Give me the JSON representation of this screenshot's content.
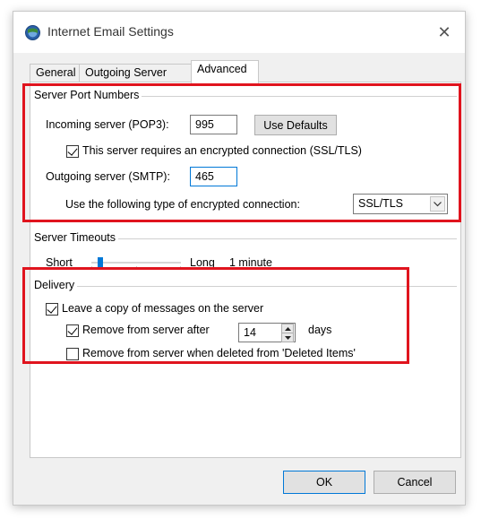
{
  "window": {
    "title": "Internet Email Settings",
    "close_glyph": "✕",
    "icon": "outlook-app-icon"
  },
  "tabs": [
    {
      "label": "General",
      "active": false
    },
    {
      "label": "Outgoing Server",
      "active": false
    },
    {
      "label": "Advanced",
      "active": true
    }
  ],
  "server_ports": {
    "title": "Server Port Numbers",
    "incoming_label": "Incoming server (POP3):",
    "incoming_value": "995",
    "use_defaults_label": "Use Defaults",
    "ssl_checkbox_label": "This server requires an encrypted connection (SSL/TLS)",
    "ssl_checked": true,
    "outgoing_label": "Outgoing server (SMTP):",
    "outgoing_value": "465",
    "encryption_label": "Use the following type of encrypted connection:",
    "encryption_value": "SSL/TLS"
  },
  "server_timeouts": {
    "title": "Server Timeouts",
    "short_label": "Short",
    "long_label": "Long",
    "value_text": "1 minute",
    "slider_fraction": 0.1
  },
  "delivery": {
    "title": "Delivery",
    "leave_copy_label": "Leave a copy of messages on the server",
    "leave_copy_checked": true,
    "remove_after_label": "Remove from server after",
    "remove_after_checked": true,
    "remove_after_days": "14",
    "days_label": "days",
    "remove_deleted_label": "Remove from server when deleted from 'Deleted Items'",
    "remove_deleted_checked": false
  },
  "buttons": {
    "ok_label": "OK",
    "cancel_label": "Cancel"
  },
  "colors": {
    "highlight_box": "#e0141e",
    "accent": "#0078d7"
  }
}
